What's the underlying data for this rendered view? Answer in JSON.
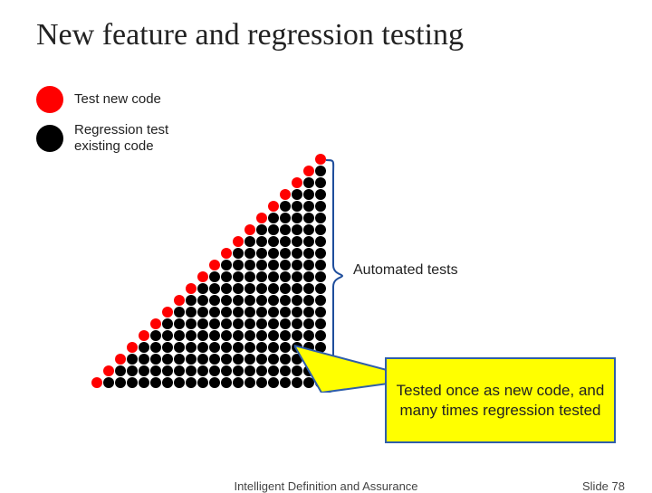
{
  "title": "New feature and regression testing",
  "legend": {
    "new_code": "Test new code",
    "regression": "Regression test\nexisting code"
  },
  "bracket_label": "Automated tests",
  "callout": "Tested once as new code, and many times regression tested",
  "footer": {
    "center": "Intelligent Definition and Assurance",
    "right_prefix": "Slide ",
    "slide_number": "78"
  },
  "colors": {
    "new": "#ff0000",
    "regression": "#000000",
    "bracket": "#1f4e9c",
    "callout_bg": "#ffff00",
    "callout_border": "#2f5eaa"
  },
  "chart_data": {
    "type": "diagram",
    "rows": 20,
    "description": "Right-aligned triangle of dots with 20 rows. Row n (1=top) contains n dots. The leftmost dot in each row is red (new test); remaining dots are black (regression tests run repeatedly).",
    "series": [
      {
        "name": "Test new code",
        "color": "#ff0000",
        "count_per_row": "1 (leftmost)"
      },
      {
        "name": "Regression test existing code",
        "color": "#000000",
        "count_per_row": "n-1"
      }
    ]
  }
}
